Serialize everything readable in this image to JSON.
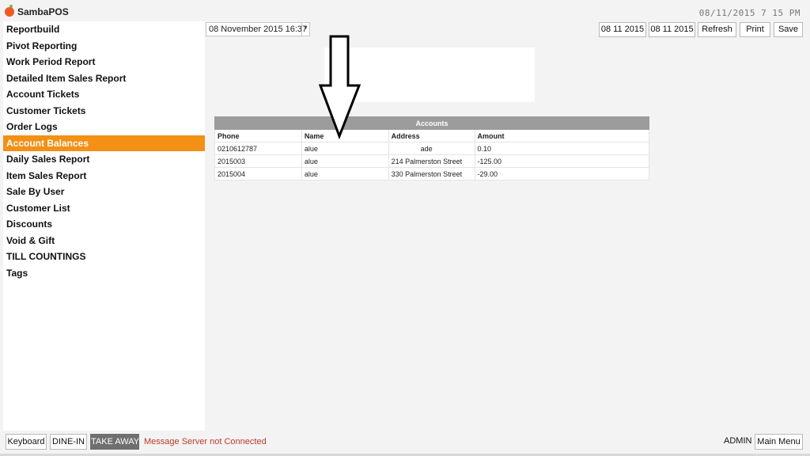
{
  "app": {
    "title": "SambaPOS",
    "datetime": "08/11/2015 7 15 PM"
  },
  "sidebar": {
    "items": [
      {
        "label": "Reportbuild"
      },
      {
        "label": "Pivot Reporting"
      },
      {
        "label": "Work Period Report"
      },
      {
        "label": "Detailed Item Sales Report"
      },
      {
        "label": "Account Tickets"
      },
      {
        "label": "Customer Tickets"
      },
      {
        "label": "Order Logs"
      },
      {
        "label": "Account Balances",
        "active": true
      },
      {
        "label": "Daily Sales Report"
      },
      {
        "label": "Item Sales Report"
      },
      {
        "label": "Sale By User"
      },
      {
        "label": "Customer List"
      },
      {
        "label": "Discounts"
      },
      {
        "label": "Void & Gift"
      },
      {
        "label": "TILL COUNTINGS"
      },
      {
        "label": "Tags"
      }
    ]
  },
  "toolbar": {
    "period_value": "08 November 2015 16:37",
    "start_date": "08 11 2015",
    "end_date": "08 11 2015",
    "refresh_label": "Refresh",
    "print_label": "Print",
    "save_label": "Save"
  },
  "report": {
    "title": "Accounts",
    "columns": [
      "Phone",
      "Name",
      "Address",
      "Amount"
    ],
    "rows": [
      [
        "0210612787",
        "alue",
        "ade",
        "0.10"
      ],
      [
        "2015003",
        "alue",
        "214 Palmerston Street",
        "-125.00"
      ],
      [
        "2015004",
        "alue",
        "330 Palmerston Street",
        "-29.00"
      ]
    ]
  },
  "bottom": {
    "keyboard_label": "Keyboard",
    "dinein_label": "DINE-IN",
    "takeaway_label": "TAKE AWAY",
    "status_message": "Message Server not Connected",
    "user": "ADMIN",
    "main_menu_label": "Main Menu"
  },
  "colors": {
    "accent": "#f39015",
    "status_error": "#c0392b",
    "table_header": "#9c9c9c"
  }
}
